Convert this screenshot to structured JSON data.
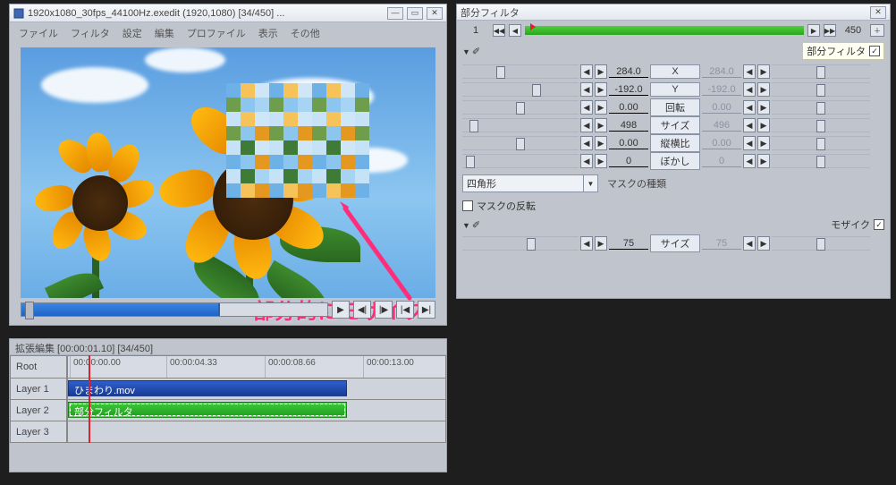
{
  "preview": {
    "title": "1920x1080_30fps_44100Hz.exedit (1920,1080) [34/450] ...",
    "menu": [
      "ファイル",
      "フィルタ",
      "設定",
      "編集",
      "プロファイル",
      "表示",
      "その他"
    ],
    "annotation": "部分的にモザイク"
  },
  "timeline": {
    "title": "拡張編集 [00:00:01.10] [34/450]",
    "root": "Root",
    "ticks": [
      "00:00:00.00",
      "00:00:04.33",
      "00:00:08.66",
      "00:00:13.00"
    ],
    "layers": [
      {
        "label": "Layer 1",
        "clip": "ひまわり.mov",
        "type": "video"
      },
      {
        "label": "Layer 2",
        "clip": "部分フィルタ",
        "type": "filter"
      },
      {
        "label": "Layer 3",
        "clip": null,
        "type": null
      }
    ]
  },
  "filter": {
    "title": "部分フィルタ",
    "frame_start": "1",
    "frame_end": "450",
    "section1_icon": "✐",
    "tooltip": "部分フィルタ",
    "params": [
      {
        "label": "X",
        "valL": "284.0",
        "valR": "284.0",
        "knobL": 38,
        "knobR": 50,
        "muteR": true
      },
      {
        "label": "Y",
        "valL": "-192.0",
        "valR": "-192.0",
        "knobL": 78,
        "knobR": 50,
        "muteR": true
      },
      {
        "label": "回転",
        "valL": "0.00",
        "valR": "0.00",
        "knobL": 60,
        "knobR": 50,
        "muteR": true
      },
      {
        "label": "サイズ",
        "valL": "498",
        "valR": "496",
        "knobL": 8,
        "knobR": 50,
        "muteR": true
      },
      {
        "label": "縦横比",
        "valL": "0.00",
        "valR": "0.00",
        "knobL": 60,
        "knobR": 50,
        "muteR": true
      },
      {
        "label": "ぼかし",
        "valL": "0",
        "valR": "0",
        "knobL": 4,
        "knobR": 50,
        "muteR": true
      }
    ],
    "mask_type_selected": "四角形",
    "mask_type_label": "マスクの種類",
    "invert_label": "マスクの反転",
    "section2_label": "モザイク",
    "size_label": "サイズ",
    "size_valL": "75",
    "size_valR": "75"
  }
}
